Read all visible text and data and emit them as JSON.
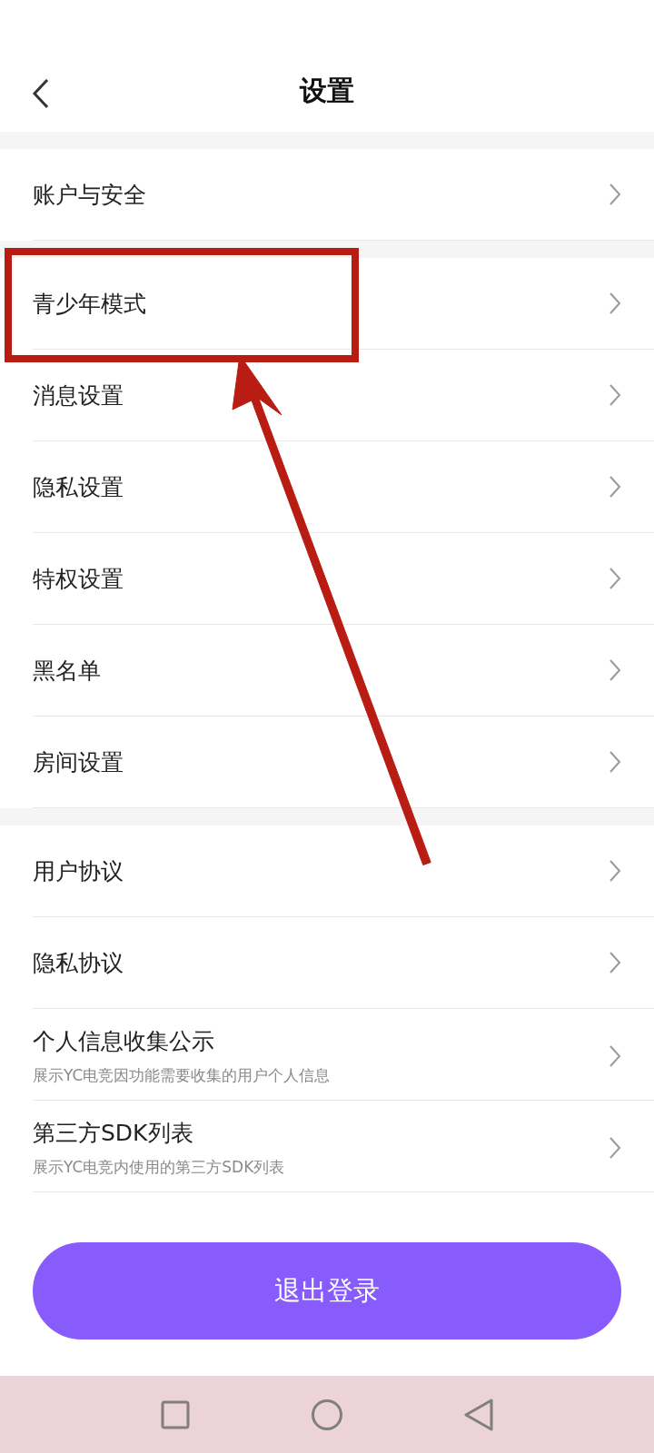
{
  "header": {
    "title": "设置"
  },
  "sections": [
    {
      "items": [
        {
          "label": "账户与安全",
          "highlighted": false
        }
      ]
    },
    {
      "items": [
        {
          "label": "青少年模式",
          "highlighted": true
        },
        {
          "label": "消息设置",
          "highlighted": false
        },
        {
          "label": "隐私设置",
          "highlighted": false
        },
        {
          "label": "特权设置",
          "highlighted": false
        },
        {
          "label": "黑名单",
          "highlighted": false
        },
        {
          "label": "房间设置",
          "highlighted": false
        }
      ]
    },
    {
      "items": [
        {
          "label": "用户协议",
          "highlighted": false
        },
        {
          "label": "隐私协议",
          "highlighted": false
        },
        {
          "label": "个人信息收集公示",
          "subtitle": "展示YC电竞因功能需要收集的用户个人信息",
          "highlighted": false
        },
        {
          "label": "第三方SDK列表",
          "subtitle": "展示YC电竞内使用的第三方SDK列表",
          "highlighted": false
        }
      ]
    }
  ],
  "logout_button": "退出登录"
}
